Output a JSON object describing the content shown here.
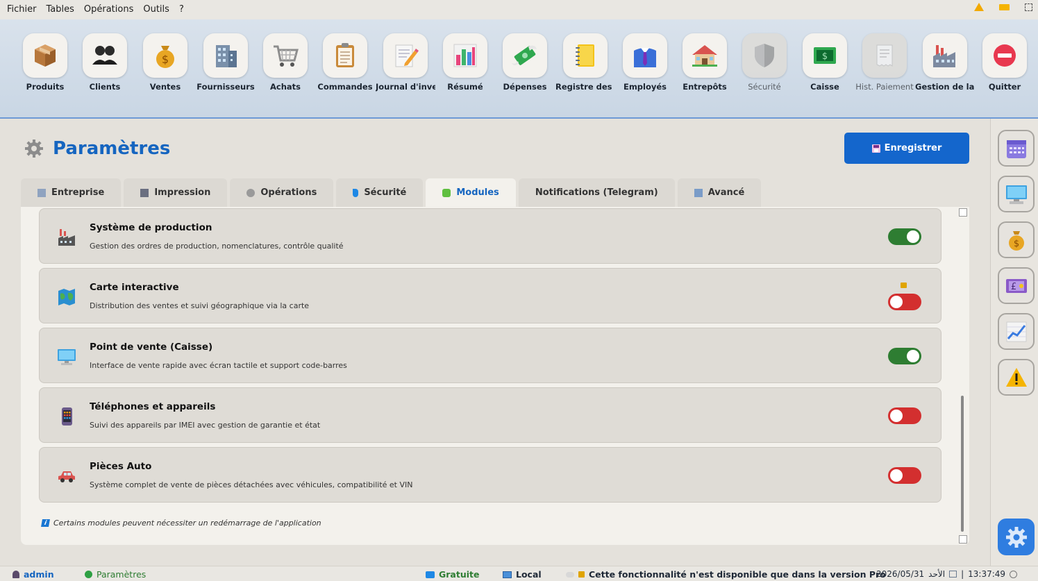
{
  "menu": [
    "Fichier",
    "Tables",
    "Opérations",
    "Outils",
    "?"
  ],
  "toolbar": [
    {
      "label": "Produits",
      "icon": "box-icon"
    },
    {
      "label": "Clients",
      "icon": "people-icon"
    },
    {
      "label": "Ventes",
      "icon": "money-bag-icon"
    },
    {
      "label": "Fournisseurs",
      "icon": "building-icon"
    },
    {
      "label": "Achats",
      "icon": "cart-icon"
    },
    {
      "label": "Commandes",
      "icon": "clipboard-icon"
    },
    {
      "label": "Journal d'inventa",
      "icon": "notepad-icon"
    },
    {
      "label": "Résumé",
      "icon": "bar-chart-icon"
    },
    {
      "label": "Dépenses",
      "icon": "money-wings-icon"
    },
    {
      "label": "Registre des Dette",
      "icon": "ledger-icon"
    },
    {
      "label": "Employés",
      "icon": "employee-icon"
    },
    {
      "label": "Entrepôts",
      "icon": "warehouse-icon"
    },
    {
      "label": "Sécurité",
      "icon": "shield-icon"
    },
    {
      "label": "Caisse",
      "icon": "cash-icon"
    },
    {
      "label": "Hist. Paiement",
      "icon": "receipt-icon"
    },
    {
      "label": "Gestion de la produ",
      "icon": "factory-icon"
    },
    {
      "label": "Quitter",
      "icon": "quit-icon"
    }
  ],
  "page": {
    "title": "Paramètres",
    "save_label": "Enregistrer"
  },
  "tabs": [
    {
      "label": "Entreprise",
      "active": false
    },
    {
      "label": "Impression",
      "active": false
    },
    {
      "label": "Opérations",
      "active": false
    },
    {
      "label": "Sécurité",
      "active": false
    },
    {
      "label": "Modules",
      "active": true
    },
    {
      "label": "Notifications (Telegram)",
      "active": false
    },
    {
      "label": "Avancé",
      "active": false
    }
  ],
  "modules": [
    {
      "title": "Système de production",
      "description": "Gestion des ordres de production, nomenclatures, contrôle qualité",
      "enabled": true,
      "locked": false,
      "icon": "factory-icon"
    },
    {
      "title": "Carte interactive",
      "description": "Distribution des ventes et suivi géographique via la carte",
      "enabled": false,
      "locked": true,
      "icon": "map-icon"
    },
    {
      "title": "Point de vente (Caisse)",
      "description": "Interface de vente rapide avec écran tactile et support code-barres",
      "enabled": true,
      "locked": false,
      "icon": "monitor-icon"
    },
    {
      "title": "Téléphones et appareils",
      "description": "Suivi des appareils par IMEI avec gestion de garantie et état",
      "enabled": false,
      "locked": false,
      "icon": "phone-icon"
    },
    {
      "title": "Pièces Auto",
      "description": "Système complet de vente de pièces détachées avec véhicules, compatibilité et VIN",
      "enabled": false,
      "locked": false,
      "icon": "car-icon"
    }
  ],
  "note": "Certains modules peuvent nécessiter un redémarrage de l'application",
  "status": {
    "user": "admin",
    "section": "Paramètres",
    "license": "Gratuite",
    "mode": "Local",
    "pro_message": "Cette fonctionnalité n'est disponible que dans la version Pro",
    "date": "2026/05/31",
    "day": "الأحد",
    "time": "13:37:49",
    "separator": "|"
  },
  "colors": {
    "accent": "#1466cc",
    "toggle_on": "#2e7d32",
    "toggle_off": "#d32f2f"
  }
}
